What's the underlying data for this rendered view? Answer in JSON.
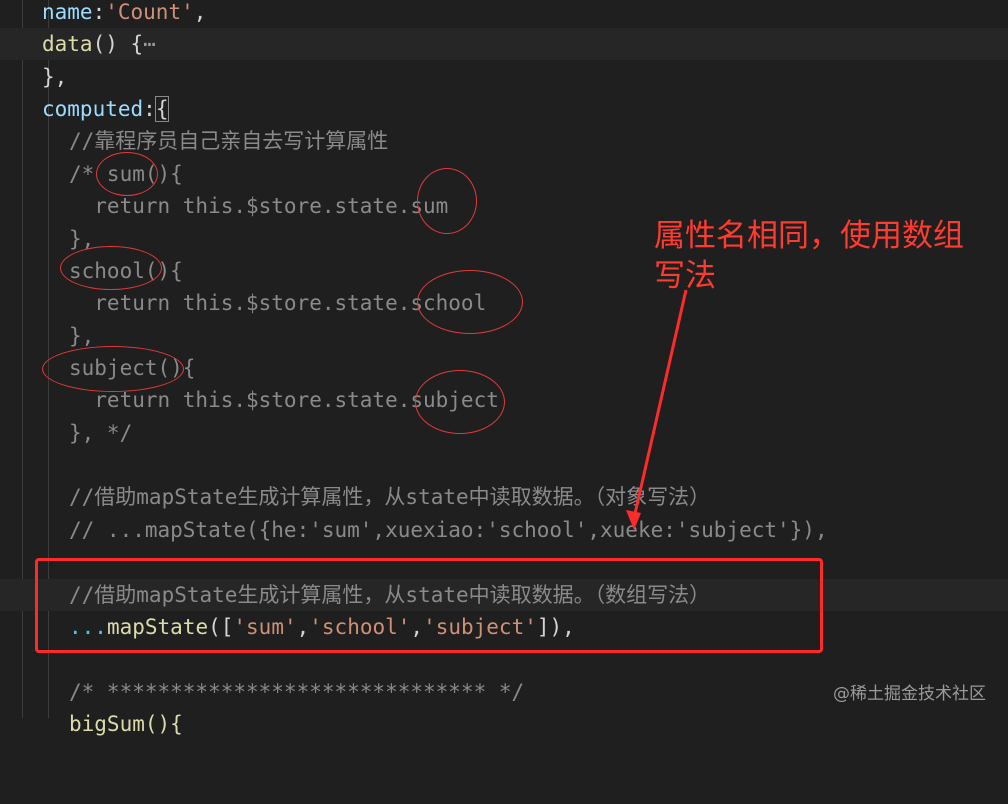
{
  "code": {
    "l1_name": "name",
    "l1_colon": ":",
    "l1_value": "'Count'",
    "l1_comma": ",",
    "l2_fn": "data",
    "l2_rest": "() {",
    "l2_fold": "⋯",
    "l3": "},",
    "l4_kw": "computed",
    "l4_colon": ":",
    "l4_brace": "{",
    "l5": "//靠程序员自己亲自去写计算属性",
    "l6": "/* sum(){",
    "l7": "  return this.$store.state.sum",
    "l8": "},",
    "l9": "school(){",
    "l10": "  return this.$store.state.school",
    "l11": "},",
    "l12": "subject(){",
    "l13": "  return this.$store.state.subject",
    "l14": "}, */",
    "l16": "//借助mapState生成计算属性，从state中读取数据。（对象写法）",
    "l17": "// ...mapState({he:'sum',xuexiao:'school',xueke:'subject'}),",
    "l19": "//借助mapState生成计算属性，从state中读取数据。（数组写法）",
    "l20_spread": "...",
    "l20_fn": "mapState",
    "l20_open": "([",
    "l20_s1": "'sum'",
    "l20_c1": ",",
    "l20_s2": "'school'",
    "l20_c2": ",",
    "l20_s3": "'subject'",
    "l20_close": "]),",
    "l22": "/* ****************************** */",
    "l23": "bigSum(){"
  },
  "annotation": {
    "line1": "属性名相同，使用数组",
    "line2": "写法"
  },
  "watermark": "@稀土掘金技术社区",
  "colors": {
    "accent_red": "#ff2a2a",
    "background": "#1f1f1f"
  }
}
